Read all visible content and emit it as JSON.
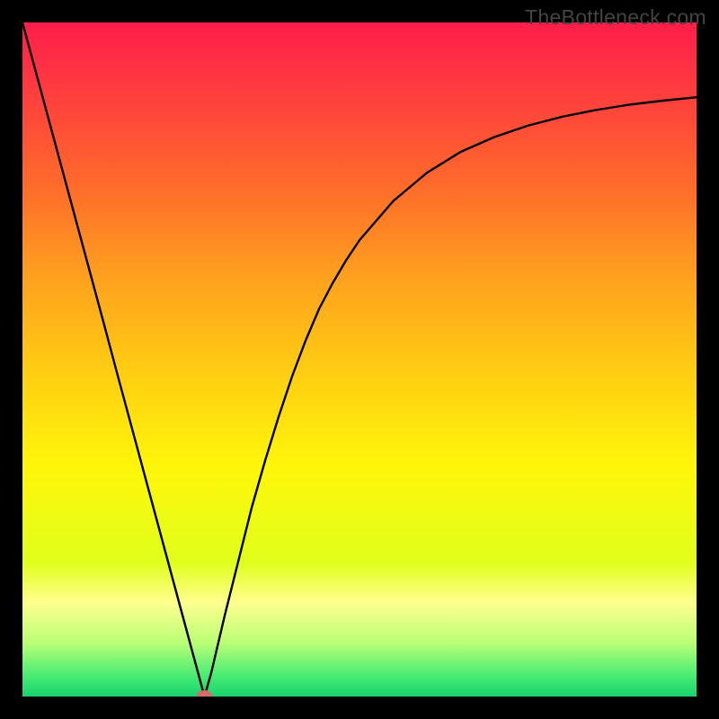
{
  "watermark": "TheBottleneck.com",
  "chart_data": {
    "type": "line",
    "title": "",
    "xlabel": "",
    "ylabel": "",
    "xlim": [
      0,
      100
    ],
    "ylim": [
      0,
      100
    ],
    "x": [
      0,
      2,
      4,
      6,
      8,
      10,
      12,
      14,
      16,
      18,
      20,
      22,
      24,
      26,
      27,
      28,
      30,
      32,
      34,
      36,
      38,
      40,
      42,
      44,
      46,
      48,
      50,
      55,
      60,
      65,
      70,
      75,
      80,
      85,
      90,
      95,
      100
    ],
    "values": [
      100,
      92.6,
      85.2,
      77.8,
      70.4,
      63.0,
      55.6,
      48.1,
      40.7,
      33.3,
      25.9,
      18.5,
      11.1,
      3.7,
      0.0,
      3.5,
      12.0,
      20.0,
      28.0,
      35.0,
      41.5,
      47.5,
      52.8,
      57.5,
      61.3,
      64.7,
      67.7,
      73.5,
      77.7,
      80.8,
      83.0,
      84.7,
      86.0,
      87.0,
      87.8,
      88.4,
      88.9
    ],
    "marker": {
      "x": 27,
      "y": 0
    },
    "background_gradient": {
      "stops": [
        {
          "offset": 0.0,
          "color": "#ff1d4b"
        },
        {
          "offset": 0.1,
          "color": "#ff3c3f"
        },
        {
          "offset": 0.24,
          "color": "#ff6a2b"
        },
        {
          "offset": 0.38,
          "color": "#ffa11e"
        },
        {
          "offset": 0.52,
          "color": "#ffce12"
        },
        {
          "offset": 0.66,
          "color": "#fff60a"
        },
        {
          "offset": 0.8,
          "color": "#e0ff1a"
        },
        {
          "offset": 0.86,
          "color": "#ffff8e"
        },
        {
          "offset": 0.92,
          "color": "#baff76"
        },
        {
          "offset": 0.97,
          "color": "#47eb73"
        },
        {
          "offset": 1.0,
          "color": "#18d36c"
        }
      ]
    }
  }
}
